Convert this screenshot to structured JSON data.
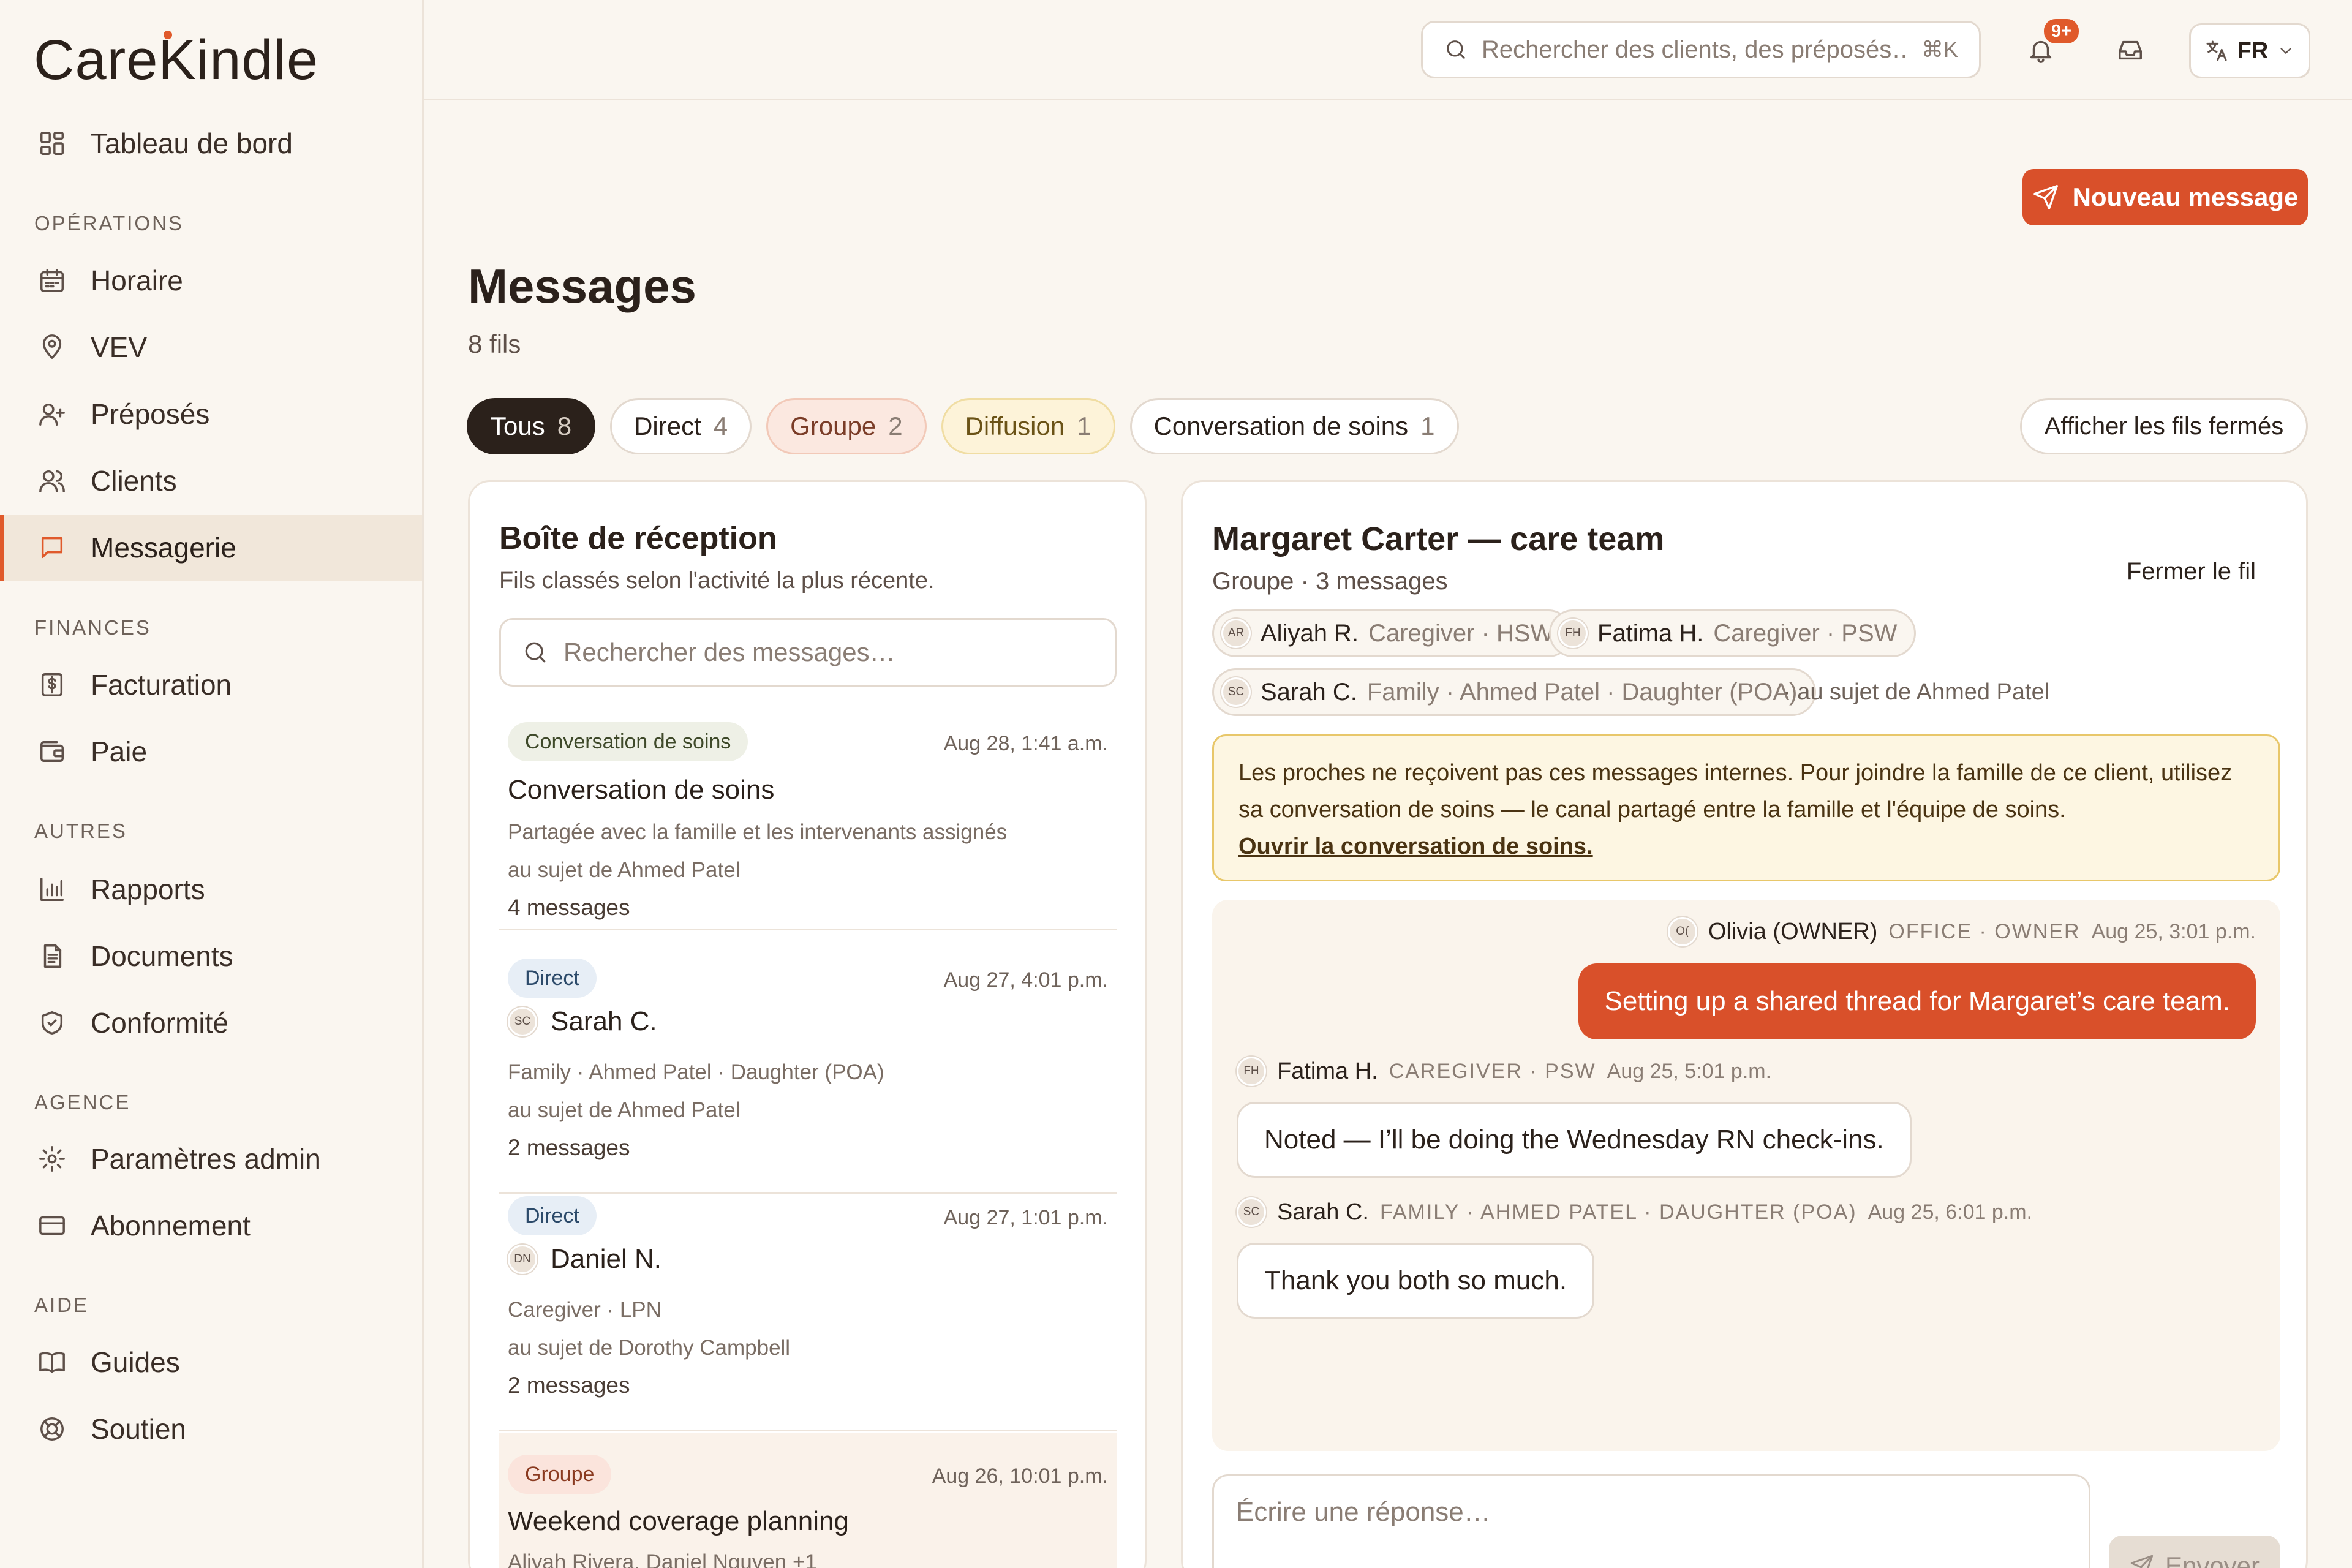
{
  "brand": {
    "name_a": "Care",
    "name_k": "K",
    "name_b": "indle"
  },
  "nav": {
    "dashboard": "Tableau de bord",
    "sections": {
      "operations": "OPÉRATIONS",
      "finances": "FINANCES",
      "autres": "AUTRES",
      "agence": "AGENCE",
      "aide": "AIDE"
    },
    "items": {
      "horaire": "Horaire",
      "vev": "VEV",
      "preposes": "Préposés",
      "clients": "Clients",
      "messagerie": "Messagerie",
      "facturation": "Facturation",
      "paie": "Paie",
      "rapports": "Rapports",
      "documents": "Documents",
      "conformite": "Conformité",
      "parametres": "Paramètres admin",
      "abonnement": "Abonnement",
      "guides": "Guides",
      "soutien": "Soutien"
    },
    "icons": [
      "grid-icon",
      "calendar-icon",
      "map-pin-icon",
      "user-plus-icon",
      "users-icon",
      "chat-icon",
      "dollar-icon",
      "wallet-icon",
      "bar-chart-icon",
      "document-icon",
      "shield-icon",
      "gear-icon",
      "card-icon",
      "book-icon",
      "lifebuoy-icon"
    ]
  },
  "topbar": {
    "search_placeholder": "Rechercher des clients, des préposés…",
    "search_shortcut": "⌘K",
    "notifications_badge": "9+",
    "language": "FR"
  },
  "header": {
    "new_message": "Nouveau message",
    "title": "Messages",
    "subtitle": "8 fils",
    "show_closed": "Afficher les fils fermés"
  },
  "filters": [
    {
      "label": "Tous",
      "count": "8"
    },
    {
      "label": "Direct",
      "count": "4"
    },
    {
      "label": "Groupe",
      "count": "2"
    },
    {
      "label": "Diffusion",
      "count": "1"
    },
    {
      "label": "Conversation de soins",
      "count": "1"
    }
  ],
  "inbox": {
    "title": "Boîte de réception",
    "subtitle": "Fils classés selon l'activité la plus récente.",
    "search_placeholder": "Rechercher des messages…",
    "threads": [
      {
        "tag": "Conversation de soins",
        "time": "Aug 28, 1:41 a.m.",
        "name": "Conversation de soins",
        "line1": "Partagée avec la famille et les intervenants assignés",
        "line2": "au sujet de Ahmed Patel",
        "count": "4 messages"
      },
      {
        "tag": "Direct",
        "time": "Aug 27, 4:01 p.m.",
        "initials": "SC",
        "name": "Sarah C.",
        "line1": "Family · Ahmed Patel · Daughter (POA)",
        "line2": "au sujet de Ahmed Patel",
        "count": "2 messages"
      },
      {
        "tag": "Direct",
        "time": "Aug 27, 1:01 p.m.",
        "initials": "DN",
        "name": "Daniel N.",
        "line1": "Caregiver · LPN",
        "line2": "au sujet de Dorothy Campbell",
        "count": "2 messages"
      },
      {
        "tag": "Groupe",
        "time": "Aug 26, 10:01 p.m.",
        "name": "Weekend coverage planning",
        "line1": "Aliyah Rivera, Daniel Nguyen +1"
      }
    ]
  },
  "conversation": {
    "title": "Margaret Carter — care team",
    "subtitle": "Groupe · 3 messages",
    "close": "Fermer le fil",
    "participants": [
      {
        "initials": "AR",
        "name": "Aliyah R.",
        "role": "Caregiver · HSW"
      },
      {
        "initials": "FH",
        "name": "Fatima H.",
        "role": "Caregiver · PSW"
      },
      {
        "initials": "SC",
        "name": "Sarah C.",
        "role": "Family · Ahmed Patel · Daughter (POA)"
      }
    ],
    "about": "· au sujet de Ahmed Patel",
    "notice": {
      "text": "Les proches ne reçoivent pas ces messages internes. Pour joindre la famille de ce client, utilisez sa conversation de soins — le canal partagé entre la famille et l'équipe de soins.",
      "link": "Ouvrir la conversation de soins."
    },
    "messages": [
      {
        "initials": "O(",
        "name": "Olivia (OWNER)",
        "role": "OFFICE · OWNER",
        "time": "Aug 25, 3:01 p.m.",
        "text": "Setting up a shared thread for Margaret’s care team."
      },
      {
        "initials": "FH",
        "name": "Fatima H.",
        "role": "CAREGIVER · PSW",
        "time": "Aug 25, 5:01 p.m.",
        "text": "Noted — I’ll be doing the Wednesday RN check-ins."
      },
      {
        "initials": "SC",
        "name": "Sarah C.",
        "role": "FAMILY · AHMED PATEL · DAUGHTER (POA)",
        "time": "Aug 25, 6:01 p.m.",
        "text": "Thank you both so much."
      }
    ],
    "reply_placeholder": "Écrire une réponse…",
    "send": "Envoyer"
  }
}
